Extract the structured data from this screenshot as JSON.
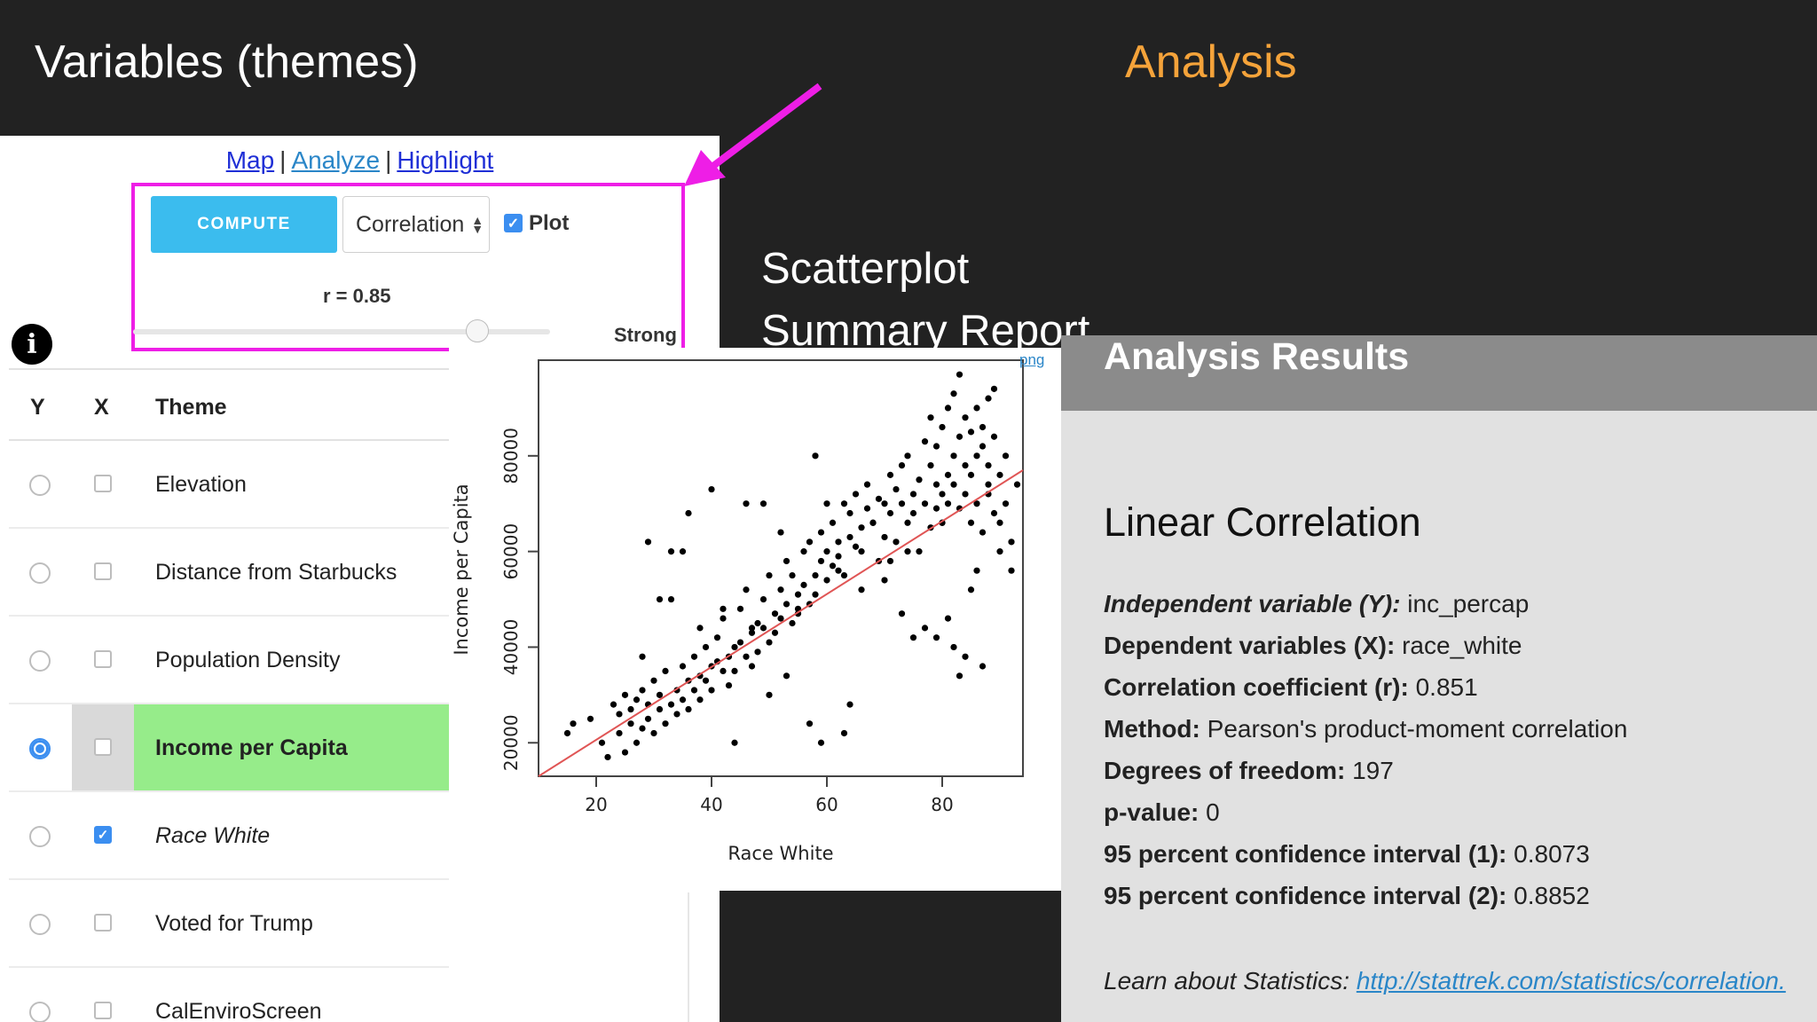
{
  "slide": {
    "title_left": "Variables (themes)",
    "title_right": "Analysis",
    "label_scatterplot": "Scatterplot",
    "label_summary": "Summary Report",
    "accent_color": "#f5a33a",
    "annotation_color": "#ee1ee6"
  },
  "app": {
    "tabs": {
      "map": "Map",
      "analyze": "Analyze",
      "highlight": "Highlight",
      "separator": "|"
    },
    "compute_button": "COMPUTE",
    "method_select": "Correlation",
    "plot_checkbox_label": "Plot",
    "plot_checked": true,
    "r_label": "r = 0.85",
    "strength_label": "Strong",
    "slider_value_fraction": 0.85,
    "info_icon": "i",
    "table": {
      "headers": {
        "y": "Y",
        "x": "X",
        "theme": "Theme"
      },
      "rows": [
        {
          "name": "Elevation",
          "y_selected": false,
          "x_checked": false
        },
        {
          "name": "Distance from Starbucks",
          "y_selected": false,
          "x_checked": false
        },
        {
          "name": "Population Density",
          "y_selected": false,
          "x_checked": false
        },
        {
          "name": "Income per Capita",
          "y_selected": true,
          "x_checked": false
        },
        {
          "name": "Race White",
          "y_selected": false,
          "x_checked": true
        },
        {
          "name": "Voted for Trump",
          "y_selected": false,
          "x_checked": false
        },
        {
          "name": "CalEnviroScreen",
          "y_selected": false,
          "x_checked": false
        }
      ]
    }
  },
  "plot": {
    "png_link": "png"
  },
  "chart_data": {
    "type": "scatter",
    "xlabel": "Race White",
    "ylabel": "Income per Capita",
    "x_ticks": [
      "20",
      "40",
      "60",
      "80"
    ],
    "y_ticks": [
      "20000",
      "40000",
      "60000",
      "80000"
    ],
    "xlim": [
      10,
      94
    ],
    "ylim": [
      13000,
      100000
    ],
    "regression_line": {
      "x": [
        10,
        94
      ],
      "y": [
        13000,
        77000
      ],
      "color": "#e05555"
    },
    "x": [
      15,
      16,
      19,
      21,
      22,
      23,
      24,
      24,
      25,
      25,
      26,
      26,
      27,
      27,
      28,
      28,
      29,
      29,
      30,
      30,
      31,
      31,
      32,
      32,
      33,
      33,
      34,
      34,
      35,
      35,
      36,
      36,
      37,
      37,
      38,
      38,
      39,
      39,
      40,
      40,
      41,
      41,
      42,
      42,
      43,
      43,
      44,
      44,
      45,
      45,
      46,
      46,
      47,
      47,
      48,
      48,
      49,
      49,
      50,
      50,
      51,
      51,
      52,
      52,
      53,
      53,
      54,
      54,
      55,
      55,
      56,
      56,
      57,
      57,
      58,
      58,
      59,
      59,
      60,
      60,
      61,
      61,
      62,
      62,
      63,
      63,
      64,
      64,
      65,
      65,
      66,
      66,
      67,
      67,
      68,
      69,
      69,
      70,
      70,
      71,
      71,
      72,
      72,
      73,
      73,
      74,
      74,
      75,
      75,
      76,
      76,
      77,
      77,
      78,
      78,
      78,
      79,
      79,
      79,
      80,
      80,
      80,
      81,
      81,
      81,
      82,
      82,
      82,
      83,
      83,
      83,
      84,
      84,
      84,
      85,
      85,
      85,
      86,
      86,
      86,
      87,
      87,
      87,
      88,
      88,
      88,
      89,
      89,
      89,
      90,
      90,
      91,
      91,
      92,
      92,
      93,
      36,
      58,
      73,
      84,
      40,
      62,
      87,
      47,
      33,
      55,
      70,
      28,
      44,
      66,
      81,
      52,
      75,
      60,
      38,
      90,
      50,
      64,
      79,
      85,
      29,
      46,
      71,
      57,
      82,
      68,
      42,
      88,
      35,
      53,
      74,
      63,
      77,
      86,
      31,
      49,
      80,
      59,
      83
    ],
    "y": [
      22000,
      24000,
      25000,
      20000,
      17000,
      28000,
      22000,
      26000,
      18000,
      30000,
      24000,
      27000,
      20000,
      29000,
      23000,
      31000,
      25000,
      28000,
      22000,
      33000,
      27000,
      30000,
      24000,
      35000,
      28000,
      50000,
      26000,
      31000,
      36000,
      29000,
      33000,
      27000,
      31000,
      38000,
      34000,
      29000,
      40000,
      33000,
      36000,
      31000,
      42000,
      37000,
      35000,
      46000,
      38000,
      32000,
      40000,
      35000,
      48000,
      41000,
      38000,
      52000,
      43000,
      36000,
      45000,
      39000,
      50000,
      44000,
      41000,
      55000,
      47000,
      43000,
      52000,
      46000,
      58000,
      49000,
      45000,
      55000,
      51000,
      47000,
      60000,
      53000,
      49000,
      62000,
      55000,
      51000,
      58000,
      64000,
      54000,
      60000,
      57000,
      66000,
      59000,
      62000,
      70000,
      55000,
      63000,
      68000,
      61000,
      72000,
      65000,
      60000,
      69000,
      74000,
      66000,
      71000,
      58000,
      70000,
      63000,
      76000,
      68000,
      73000,
      62000,
      78000,
      70000,
      66000,
      80000,
      72000,
      68000,
      75000,
      60000,
      83000,
      70000,
      65000,
      78000,
      88000,
      74000,
      69000,
      82000,
      72000,
      86000,
      66000,
      90000,
      76000,
      70000,
      93000,
      80000,
      74000,
      84000,
      69000,
      97000,
      78000,
      72000,
      88000,
      76000,
      85000,
      66000,
      90000,
      80000,
      70000,
      86000,
      64000,
      82000,
      92000,
      72000,
      78000,
      94000,
      68000,
      84000,
      76000,
      66000,
      70000,
      80000,
      62000,
      56000,
      74000,
      68000,
      80000,
      47000,
      38000,
      73000,
      56000,
      36000,
      44000,
      60000,
      48000,
      54000,
      38000,
      20000,
      52000,
      46000,
      64000,
      42000,
      70000,
      44000,
      60000,
      30000,
      28000,
      42000,
      52000,
      62000,
      70000,
      58000,
      24000,
      40000,
      66000,
      48000,
      74000,
      60000,
      34000,
      60000,
      22000,
      44000,
      56000,
      50000,
      70000,
      66000,
      20000,
      34000,
      66000,
      46000,
      76000
    ]
  },
  "results": {
    "title": "Analysis Results",
    "subtitle": "Linear Correlation",
    "rows": [
      {
        "key": "Independent variable (Y):",
        "value": "inc_percap",
        "italic": true
      },
      {
        "key": "Dependent variables (X):",
        "value": "race_white"
      },
      {
        "key": "Correlation coefficient (r):",
        "value": "0.851"
      },
      {
        "key": "Method:",
        "value": "Pearson's product-moment correlation"
      },
      {
        "key": "Degrees of freedom:",
        "value": "197"
      },
      {
        "key": "p-value:",
        "value": "0"
      },
      {
        "key": "95 percent confidence interval (1):",
        "value": "0.8073"
      },
      {
        "key": "95 percent confidence interval (2):",
        "value": "0.8852"
      }
    ],
    "learn_label": "Learn about Statistics:",
    "learn_link": "http://stattrek.com/statistics/correlation."
  }
}
